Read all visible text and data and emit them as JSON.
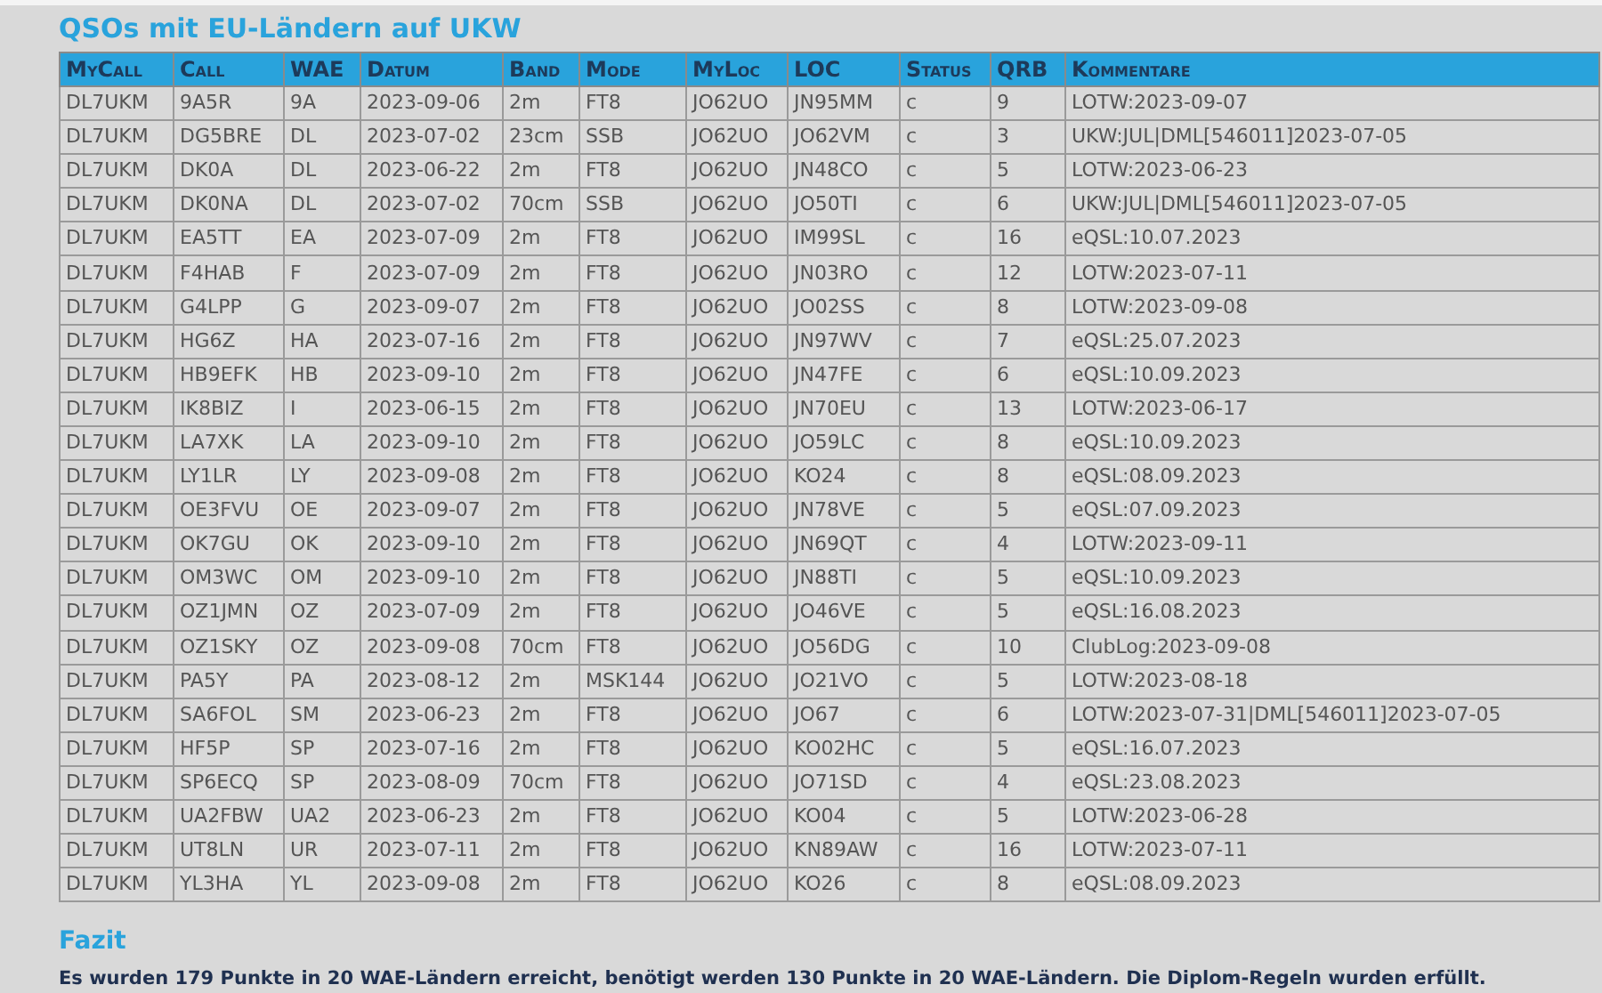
{
  "title": "QSOs mit EU-Ländern auf UKW",
  "table": {
    "columns": [
      "MyCall",
      "Call",
      "WAE",
      "Datum",
      "Band",
      "Mode",
      "MyLoc",
      "LOC",
      "Status",
      "QRB",
      "Kommentare"
    ],
    "rows": [
      [
        "DL7UKM",
        "9A5R",
        "9A",
        "2023-09-06",
        "2m",
        "FT8",
        "JO62UO",
        "JN95MM",
        "c",
        "9",
        "LOTW:2023-09-07"
      ],
      [
        "DL7UKM",
        "DG5BRE",
        "DL",
        "2023-07-02",
        "23cm",
        "SSB",
        "JO62UO",
        "JO62VM",
        "c",
        "3",
        "UKW:JUL|DML[546011]2023-07-05"
      ],
      [
        "DL7UKM",
        "DK0A",
        "DL",
        "2023-06-22",
        "2m",
        "FT8",
        "JO62UO",
        "JN48CO",
        "c",
        "5",
        "LOTW:2023-06-23"
      ],
      [
        "DL7UKM",
        "DK0NA",
        "DL",
        "2023-07-02",
        "70cm",
        "SSB",
        "JO62UO",
        "JO50TI",
        "c",
        "6",
        "UKW:JUL|DML[546011]2023-07-05"
      ],
      [
        "DL7UKM",
        "EA5TT",
        "EA",
        "2023-07-09",
        "2m",
        "FT8",
        "JO62UO",
        "IM99SL",
        "c",
        "16",
        "eQSL:10.07.2023"
      ],
      [
        "DL7UKM",
        "F4HAB",
        "F",
        "2023-07-09",
        "2m",
        "FT8",
        "JO62UO",
        "JN03RO",
        "c",
        "12",
        "LOTW:2023-07-11"
      ],
      [
        "DL7UKM",
        "G4LPP",
        "G",
        "2023-09-07",
        "2m",
        "FT8",
        "JO62UO",
        "JO02SS",
        "c",
        "8",
        "LOTW:2023-09-08"
      ],
      [
        "DL7UKM",
        "HG6Z",
        "HA",
        "2023-07-16",
        "2m",
        "FT8",
        "JO62UO",
        "JN97WV",
        "c",
        "7",
        "eQSL:25.07.2023"
      ],
      [
        "DL7UKM",
        "HB9EFK",
        "HB",
        "2023-09-10",
        "2m",
        "FT8",
        "JO62UO",
        "JN47FE",
        "c",
        "6",
        "eQSL:10.09.2023"
      ],
      [
        "DL7UKM",
        "IK8BIZ",
        "I",
        "2023-06-15",
        "2m",
        "FT8",
        "JO62UO",
        "JN70EU",
        "c",
        "13",
        "LOTW:2023-06-17"
      ],
      [
        "DL7UKM",
        "LA7XK",
        "LA",
        "2023-09-10",
        "2m",
        "FT8",
        "JO62UO",
        "JO59LC",
        "c",
        "8",
        "eQSL:10.09.2023"
      ],
      [
        "DL7UKM",
        "LY1LR",
        "LY",
        "2023-09-08",
        "2m",
        "FT8",
        "JO62UO",
        "KO24",
        "c",
        "8",
        "eQSL:08.09.2023"
      ],
      [
        "DL7UKM",
        "OE3FVU",
        "OE",
        "2023-09-07",
        "2m",
        "FT8",
        "JO62UO",
        "JN78VE",
        "c",
        "5",
        "eQSL:07.09.2023"
      ],
      [
        "DL7UKM",
        "OK7GU",
        "OK",
        "2023-09-10",
        "2m",
        "FT8",
        "JO62UO",
        "JN69QT",
        "c",
        "4",
        "LOTW:2023-09-11"
      ],
      [
        "DL7UKM",
        "OM3WC",
        "OM",
        "2023-09-10",
        "2m",
        "FT8",
        "JO62UO",
        "JN88TI",
        "c",
        "5",
        "eQSL:10.09.2023"
      ],
      [
        "DL7UKM",
        "OZ1JMN",
        "OZ",
        "2023-07-09",
        "2m",
        "FT8",
        "JO62UO",
        "JO46VE",
        "c",
        "5",
        "eQSL:16.08.2023"
      ],
      [
        "DL7UKM",
        "OZ1SKY",
        "OZ",
        "2023-09-08",
        "70cm",
        "FT8",
        "JO62UO",
        "JO56DG",
        "c",
        "10",
        "ClubLog:2023-09-08"
      ],
      [
        "DL7UKM",
        "PA5Y",
        "PA",
        "2023-08-12",
        "2m",
        "MSK144",
        "JO62UO",
        "JO21VO",
        "c",
        "5",
        "LOTW:2023-08-18"
      ],
      [
        "DL7UKM",
        "SA6FOL",
        "SM",
        "2023-06-23",
        "2m",
        "FT8",
        "JO62UO",
        "JO67",
        "c",
        "6",
        "LOTW:2023-07-31|DML[546011]2023-07-05"
      ],
      [
        "DL7UKM",
        "HF5P",
        "SP",
        "2023-07-16",
        "2m",
        "FT8",
        "JO62UO",
        "KO02HC",
        "c",
        "5",
        "eQSL:16.07.2023"
      ],
      [
        "DL7UKM",
        "SP6ECQ",
        "SP",
        "2023-08-09",
        "70cm",
        "FT8",
        "JO62UO",
        "JO71SD",
        "c",
        "4",
        "eQSL:23.08.2023"
      ],
      [
        "DL7UKM",
        "UA2FBW",
        "UA2",
        "2023-06-23",
        "2m",
        "FT8",
        "JO62UO",
        "KO04",
        "c",
        "5",
        "LOTW:2023-06-28"
      ],
      [
        "DL7UKM",
        "UT8LN",
        "UR",
        "2023-07-11",
        "2m",
        "FT8",
        "JO62UO",
        "KN89AW",
        "c",
        "16",
        "LOTW:2023-07-11"
      ],
      [
        "DL7UKM",
        "YL3HA",
        "YL",
        "2023-09-08",
        "2m",
        "FT8",
        "JO62UO",
        "KO26",
        "c",
        "8",
        "eQSL:08.09.2023"
      ]
    ]
  },
  "summary": {
    "heading": "Fazit",
    "text": "Es wurden 179 Punkte in 20 WAE-Ländern erreicht, benötigt werden 130 Punkte in 20 WAE-Ländern. Die Diplom-Regeln wurden erfüllt."
  }
}
